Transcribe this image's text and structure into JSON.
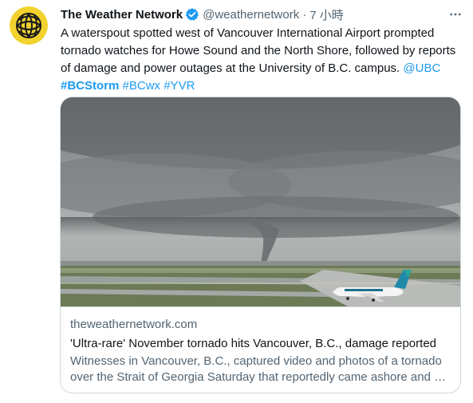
{
  "account": {
    "name": "The Weather Network",
    "handle": "@weathernetwork",
    "separator": "·",
    "time": "7 小時",
    "avatar_icon": "weather-network-globe-logo",
    "verified_icon": "verified-badge-icon",
    "more_icon": "more-options-icon"
  },
  "tweet": {
    "text": "A waterspout spotted west of Vancouver International Airport prompted tornado watches for Howe Sound and the North Shore, followed by reports of damage and power outages at the University of B.C. campus.",
    "mention": "@UBC",
    "hashtags": [
      "#BCStorm",
      "#BCwx",
      "#YVR"
    ]
  },
  "card": {
    "image_icon": "tornado-over-airport-photo",
    "domain": "theweathernetwork.com",
    "title": "'Ultra-rare' November tornado hits Vancouver, B.C., damage reported",
    "description_line1": "Witnesses in Vancouver, B.C., captured video and photos of a tornado",
    "description_line2": "over the Strait of Georgia Saturday that reportedly came ashore and …"
  },
  "colors": {
    "text": "#0f1419",
    "secondary": "#536471",
    "link": "#1d9bf0",
    "border": "#cfd9de",
    "avatar_bg": "#f2d22e"
  }
}
